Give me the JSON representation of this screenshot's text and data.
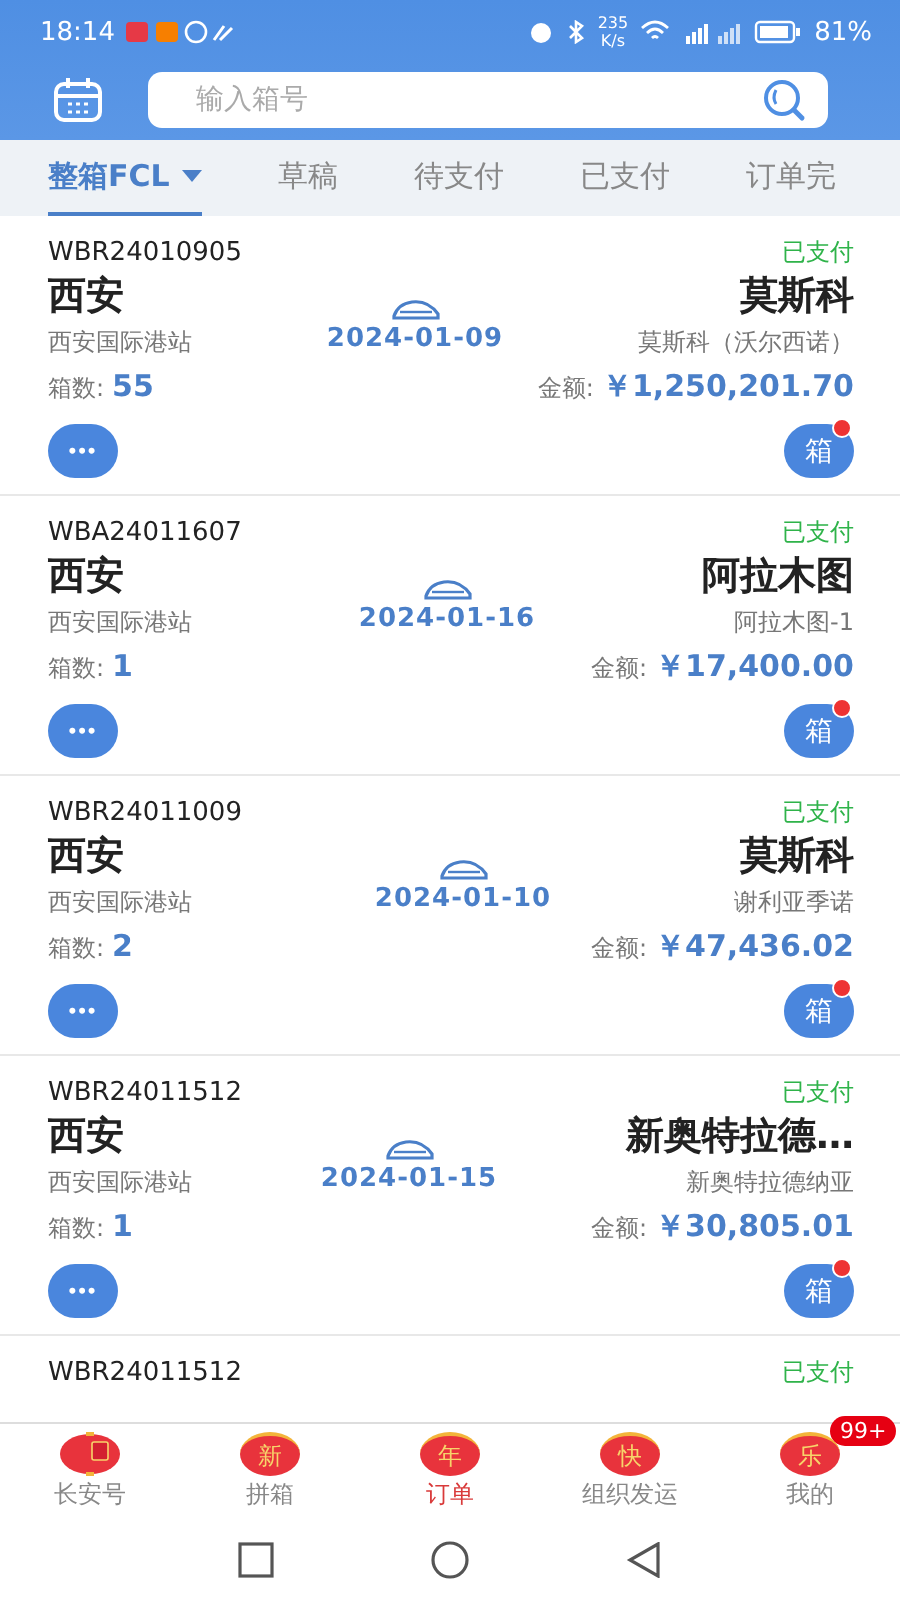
{
  "status_bar": {
    "time": "18:14",
    "speed": "235",
    "speed_unit": "K/s",
    "battery": "81%"
  },
  "search": {
    "placeholder": "输入箱号"
  },
  "tabs": [
    {
      "label": "整箱FCL",
      "selected": true,
      "dropdown": true
    },
    {
      "label": "草稿",
      "selected": false,
      "dropdown": false
    },
    {
      "label": "待支付",
      "selected": false,
      "dropdown": false
    },
    {
      "label": "已支付",
      "selected": false,
      "dropdown": false
    },
    {
      "label": "订单完",
      "selected": false,
      "dropdown": false
    }
  ],
  "orders": [
    {
      "kind": "full",
      "number": "WBR24010905",
      "status": "已支付",
      "origin": "西安",
      "origin_station": "西安国际港站",
      "count_label": "箱数:",
      "count": "55",
      "date": "2024-01-09",
      "destination": "莫斯科",
      "destination_station": "莫斯科（沃尔西诺）",
      "amount_label": "金额:",
      "amount": "￥1,250,201.70",
      "more": "•••",
      "box_button": "箱",
      "unread": true
    },
    {
      "kind": "full",
      "number": "WBA24011607",
      "status": "已支付",
      "origin": "西安",
      "origin_station": "西安国际港站",
      "count_label": "箱数:",
      "count": "1",
      "date": "2024-01-16",
      "destination": "阿拉木图",
      "destination_station": "阿拉木图-1",
      "amount_label": "金额:",
      "amount": "￥17,400.00",
      "more": "•••",
      "box_button": "箱",
      "unread": true
    },
    {
      "kind": "full",
      "number": "WBR24011009",
      "status": "已支付",
      "origin": "西安",
      "origin_station": "西安国际港站",
      "count_label": "箱数:",
      "count": "2",
      "date": "2024-01-10",
      "destination": "莫斯科",
      "destination_station": "谢利亚季诺",
      "amount_label": "金额:",
      "amount": "￥47,436.02",
      "more": "•••",
      "box_button": "箱",
      "unread": true
    },
    {
      "kind": "full",
      "number": "WBR24011512",
      "status": "已支付",
      "origin": "西安",
      "origin_station": "西安国际港站",
      "count_label": "箱数:",
      "count": "1",
      "date": "2024-01-15",
      "destination": "新奥特拉德…",
      "destination_station": "新奥特拉德纳亚",
      "amount_label": "金额:",
      "amount": "￥30,805.01",
      "more": "•••",
      "box_button": "箱",
      "unread": true
    },
    {
      "kind": "partial",
      "number": "WBR24011512",
      "status": "已支付"
    }
  ],
  "nav": [
    {
      "label": "长安号",
      "selected": false
    },
    {
      "label": "拼箱",
      "lantern": "新",
      "selected": false
    },
    {
      "label": "订单",
      "lantern": "年",
      "selected": true
    },
    {
      "label": "组织发运",
      "lantern": "快",
      "selected": false
    },
    {
      "label": "我的",
      "lantern": "乐",
      "selected": false,
      "badge": "99+"
    }
  ]
}
